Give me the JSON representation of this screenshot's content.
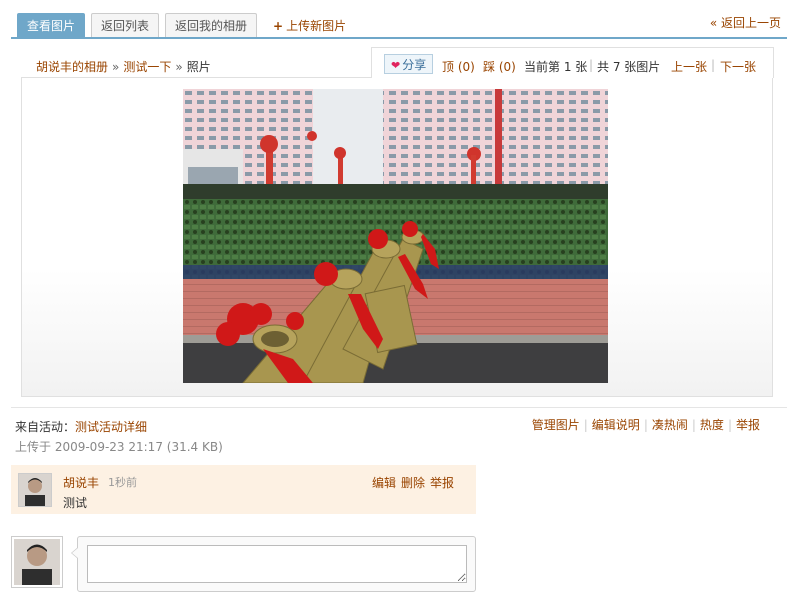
{
  "tabs": [
    {
      "label": "查看图片",
      "active": true
    },
    {
      "label": "返回列表",
      "active": false
    },
    {
      "label": "返回我的相册",
      "active": false
    }
  ],
  "upload_label": "上传新图片",
  "back_prev_label": "« 返回上一页",
  "breadcrumb": {
    "album": "胡说丰的相册",
    "sep": "»",
    "sub": "测试一下",
    "current": "照片"
  },
  "toolbar": {
    "share_label": "分享",
    "up_label": "顶 (0)",
    "down_label": "踩 (0)",
    "position_text": "当前第 1 张",
    "sep": "|",
    "total_text": "共 7 张图片",
    "prev_label": "上一张",
    "next_label": "下一张"
  },
  "meta": {
    "from_prefix": "来自活动：",
    "from_link": "测试活动详细",
    "uploaded_text": "上传于 2009-09-23 21:17 (31.4 KB)"
  },
  "photo_actions": [
    "管理图片",
    "编辑说明",
    "凑热闹",
    "热度",
    "举报"
  ],
  "comment": {
    "author": "胡说丰",
    "time": "1秒前",
    "text": "测试",
    "actions": [
      "编辑",
      "删除",
      "举报"
    ]
  },
  "reply": {
    "placeholder": ""
  },
  "colors": {
    "accent": "#6fa7c9",
    "link": "#994400",
    "comment_bg": "#fdf1e3"
  }
}
